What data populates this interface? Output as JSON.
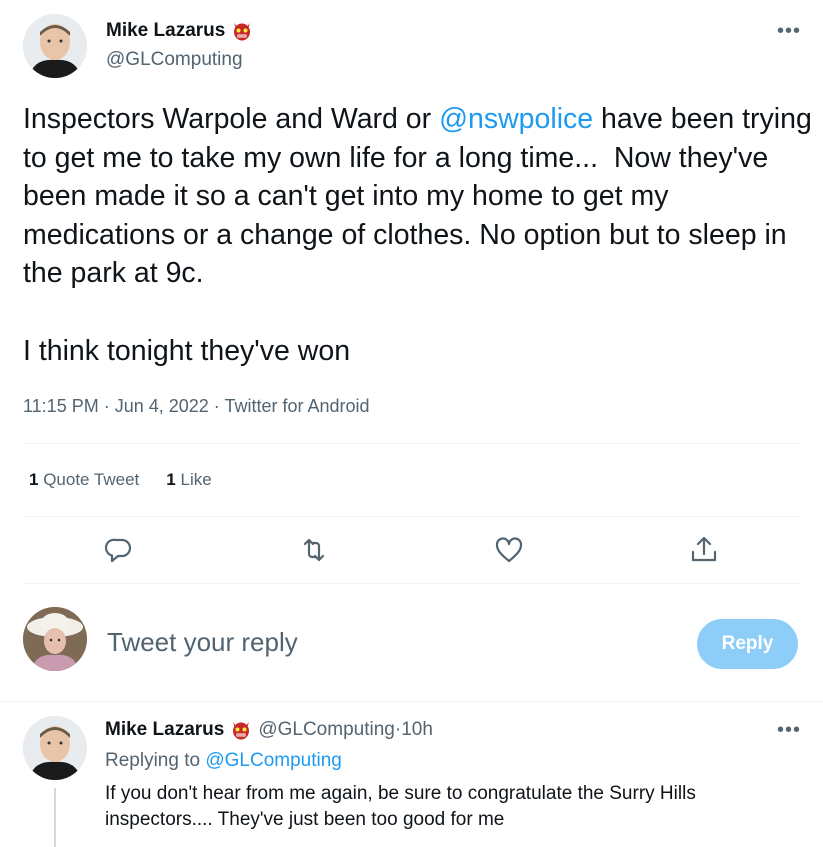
{
  "tweet": {
    "author_name": "Mike Lazarus",
    "author_emoji": "👹",
    "author_handle": "@GLComputing",
    "more_icon": "more-horizontal-icon",
    "text_before_mention": "Inspectors Warpole and Ward or ",
    "mention": "@nswpolice",
    "text_after_mention": " have been trying to get me to take my own life for a long time...  Now they've been made it so a can't get into my home to get my medications or a change of clothes. No option but to sleep in the park at 9c.\n\nI think tonight they've won",
    "time": "11:15 PM",
    "date": "Jun 4, 2022",
    "source": "Twitter for Android",
    "sep": " · "
  },
  "stats": {
    "quote_count": "1",
    "quote_label": "Quote Tweet",
    "like_count": "1",
    "like_label": "Like"
  },
  "actions": {
    "reply_icon": "reply-icon",
    "retweet_icon": "retweet-icon",
    "like_icon": "heart-icon",
    "share_icon": "share-icon"
  },
  "composer": {
    "placeholder": "Tweet your reply",
    "button_label": "Reply"
  },
  "reply_tweet": {
    "author_name": "Mike Lazarus",
    "author_emoji": "👹",
    "author_handle": "@GLComputing",
    "time_ago": "10h",
    "sep": " · ",
    "replying_prefix": "Replying to ",
    "replying_handle": "@GLComputing",
    "text": "If you don't hear from me again, be sure to congratulate the Surry Hills inspectors....  They've just been too good for me"
  },
  "colors": {
    "accent": "#1d9bf0",
    "reply_button": "#8ecdf8",
    "secondary_text": "#536471",
    "divider": "#eff3f4"
  }
}
